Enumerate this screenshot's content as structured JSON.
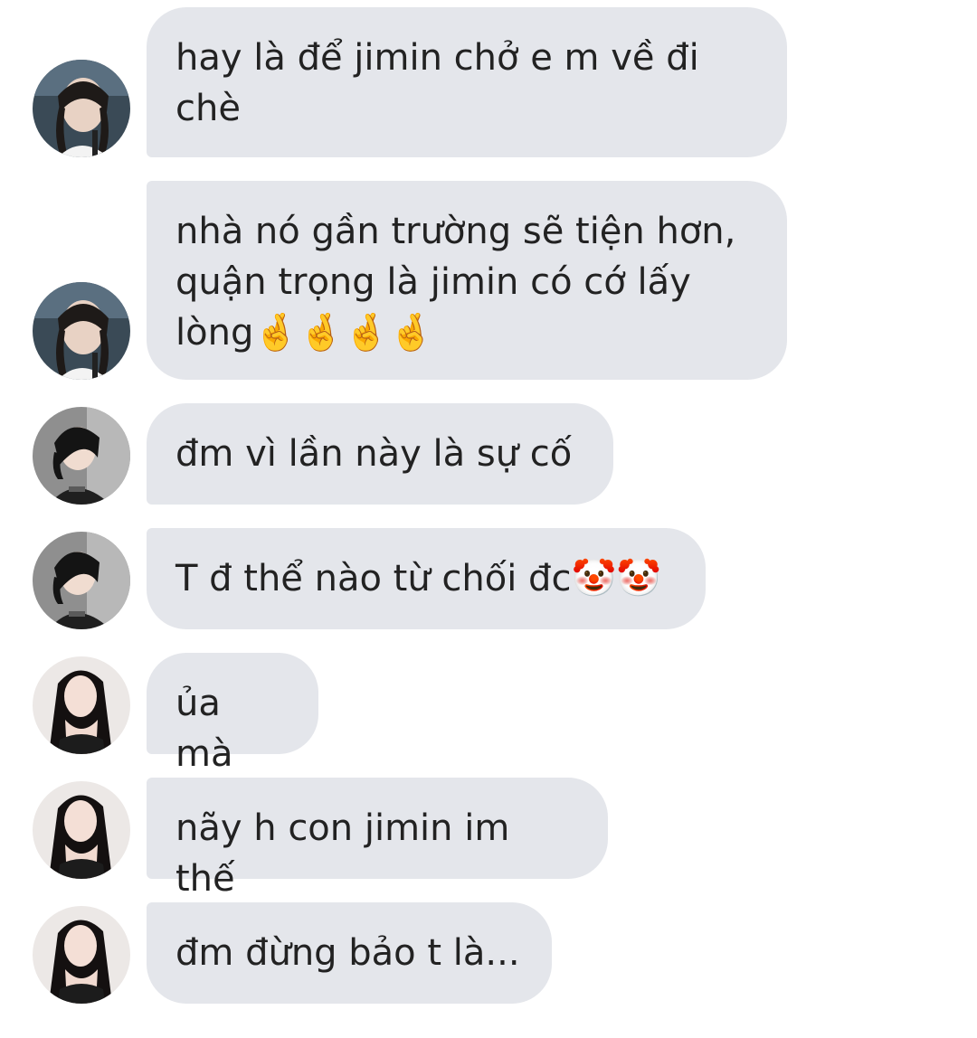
{
  "messages": [
    {
      "sender": "Hair braids avatar",
      "text": "hay là để jimin chở e m về đi\nchè"
    },
    {
      "sender": "Hair braids avatar",
      "text": "nhà nó gần trường sẽ tiện hơn,\nquận trọng là jimin có cớ lấy\nlòng🤞🤞🤞🤞"
    },
    {
      "sender": "Short hair avatar",
      "text": "đm vì lần này là sự cố"
    },
    {
      "sender": "Short hair avatar",
      "text": "T đ thể nào từ chối đc🤡🤡"
    },
    {
      "sender": "Long hair avatar",
      "text": "ủa mà"
    },
    {
      "sender": "Long hair avatar",
      "text": "nãy h con jimin im thế"
    },
    {
      "sender": "Long hair avatar",
      "text": "đm đừng bảo t là..."
    }
  ],
  "colors": {
    "bubble_bg": "#e4e6eb",
    "text": "#222222",
    "background": "#ffffff"
  }
}
